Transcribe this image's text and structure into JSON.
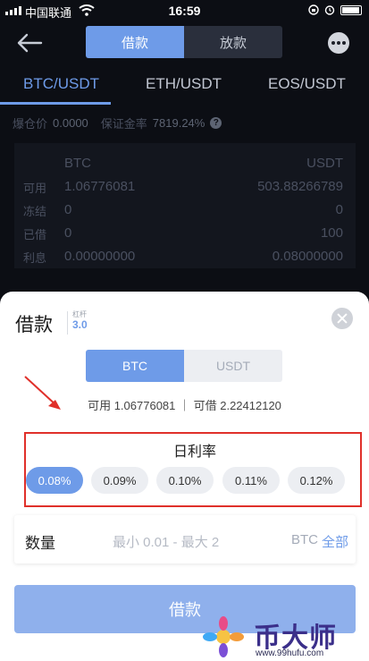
{
  "status_bar": {
    "carrier": "中国联通",
    "time": "16:59"
  },
  "header": {
    "tabs": [
      "借款",
      "放款"
    ],
    "active_tab": 0
  },
  "pairs": [
    "BTC/USDT",
    "ETH/USDT",
    "EOS/USDT"
  ],
  "active_pair": 0,
  "info": {
    "liq_label": "爆仓价",
    "liq_value": "0.0000",
    "margin_label": "保证金率",
    "margin_value": "7819.24%",
    "help": "?"
  },
  "table": {
    "headers": [
      "BTC",
      "USDT"
    ],
    "rows": [
      {
        "label": "可用",
        "btc": "1.06776081",
        "usdt": "503.88266789"
      },
      {
        "label": "冻结",
        "btc": "0",
        "usdt": "0"
      },
      {
        "label": "已借",
        "btc": "0",
        "usdt": "100"
      },
      {
        "label": "利息",
        "btc": "0.00000000",
        "usdt": "0.08000000"
      }
    ]
  },
  "modal": {
    "title": "借款",
    "leverage_label": "杠杆",
    "leverage_value": "3.0",
    "coins": [
      "BTC",
      "USDT"
    ],
    "active_coin": 0,
    "availability": "可用 1.06776081 ｜ 可借 2.22412120",
    "rate_title": "日利率",
    "rates": [
      "0.08%",
      "0.09%",
      "0.10%",
      "0.11%",
      "0.12%"
    ],
    "selected_rate": 0,
    "qty_label": "数量",
    "qty_placeholder": "最小 0.01 - 最大 2",
    "qty_unit": "BTC",
    "qty_all": "全部",
    "submit": "借款"
  },
  "watermark": {
    "name": "币大师",
    "url": "www.99hufu.com"
  },
  "colors": {
    "accent": "#6e9be8",
    "highlight_box": "#e0302a",
    "background": "#0c0e14"
  }
}
